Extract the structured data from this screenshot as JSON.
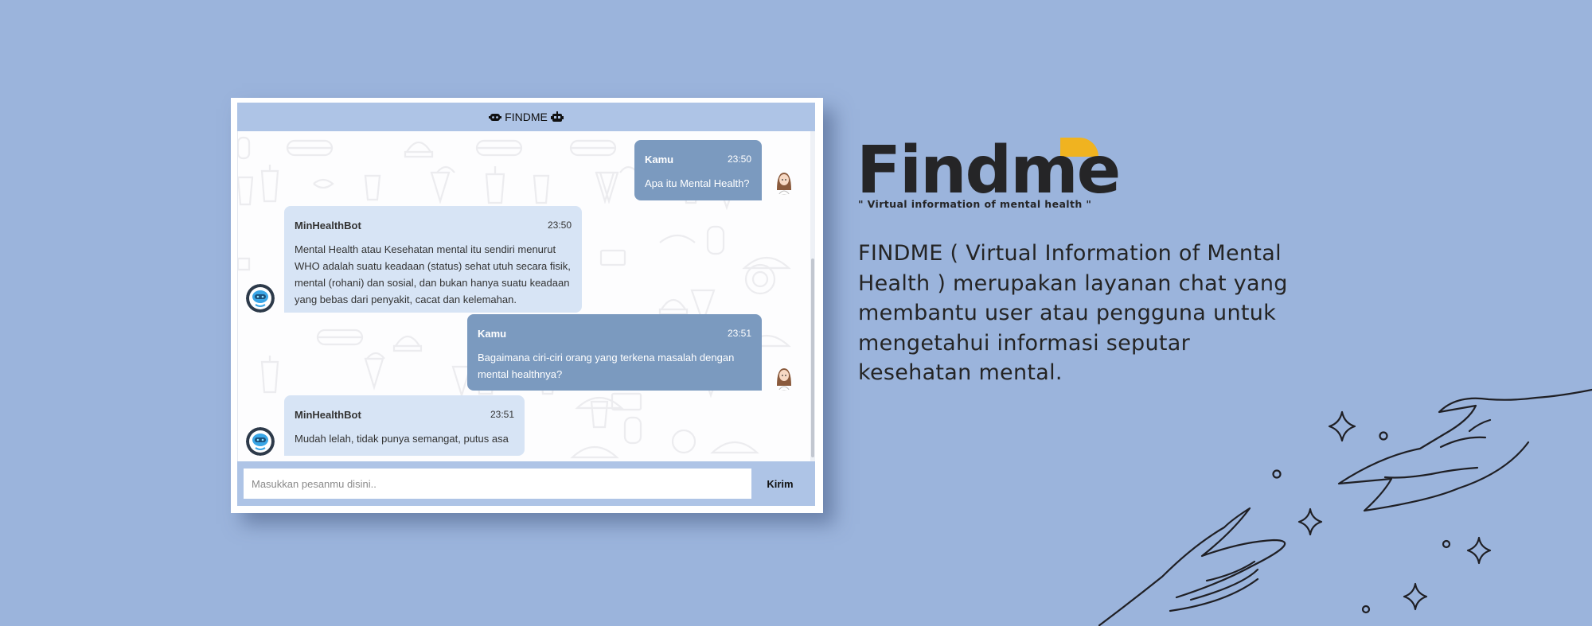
{
  "chat": {
    "title": "FINDME",
    "header_icon_left": "robot-icon",
    "header_icon_right": "robot-icon",
    "messages": [
      {
        "sender": "Kamu",
        "time": "23:50",
        "text": "Apa itu Mental Health?",
        "role": "user"
      },
      {
        "sender": "MinHealthBot",
        "time": "23:50",
        "text": "Mental Health atau Kesehatan mental itu sendiri menurut WHO adalah suatu keadaan (status) sehat utuh secara fisik, mental (rohani) dan sosial, dan bukan hanya suatu keadaan yang bebas dari penyakit, cacat dan kelemahan.",
        "role": "bot"
      },
      {
        "sender": "Kamu",
        "time": "23:51",
        "text": "Bagaimana ciri-ciri orang yang terkena masalah dengan mental healthnya?",
        "role": "user"
      },
      {
        "sender": "MinHealthBot",
        "time": "23:51",
        "text": "Mudah lelah, tidak punya semangat, putus asa",
        "role": "bot"
      }
    ],
    "input_placeholder": "Masukkan pesanmu disini..",
    "send_label": "Kirim"
  },
  "brand": {
    "logo_text": "Findme",
    "tagline": "\" Virtual information of mental health \"",
    "accent_color": "#f0b320"
  },
  "description": "FINDME ( Virtual Information of Mental Health ) merupakan layanan chat yang membantu user atau pengguna untuk mengetahui informasi seputar kesehatan mental.",
  "colors": {
    "background": "#9bb4dc",
    "header_bar": "#aec4e6",
    "user_bubble": "#7b9abf",
    "bot_bubble": "#d7e4f5"
  }
}
